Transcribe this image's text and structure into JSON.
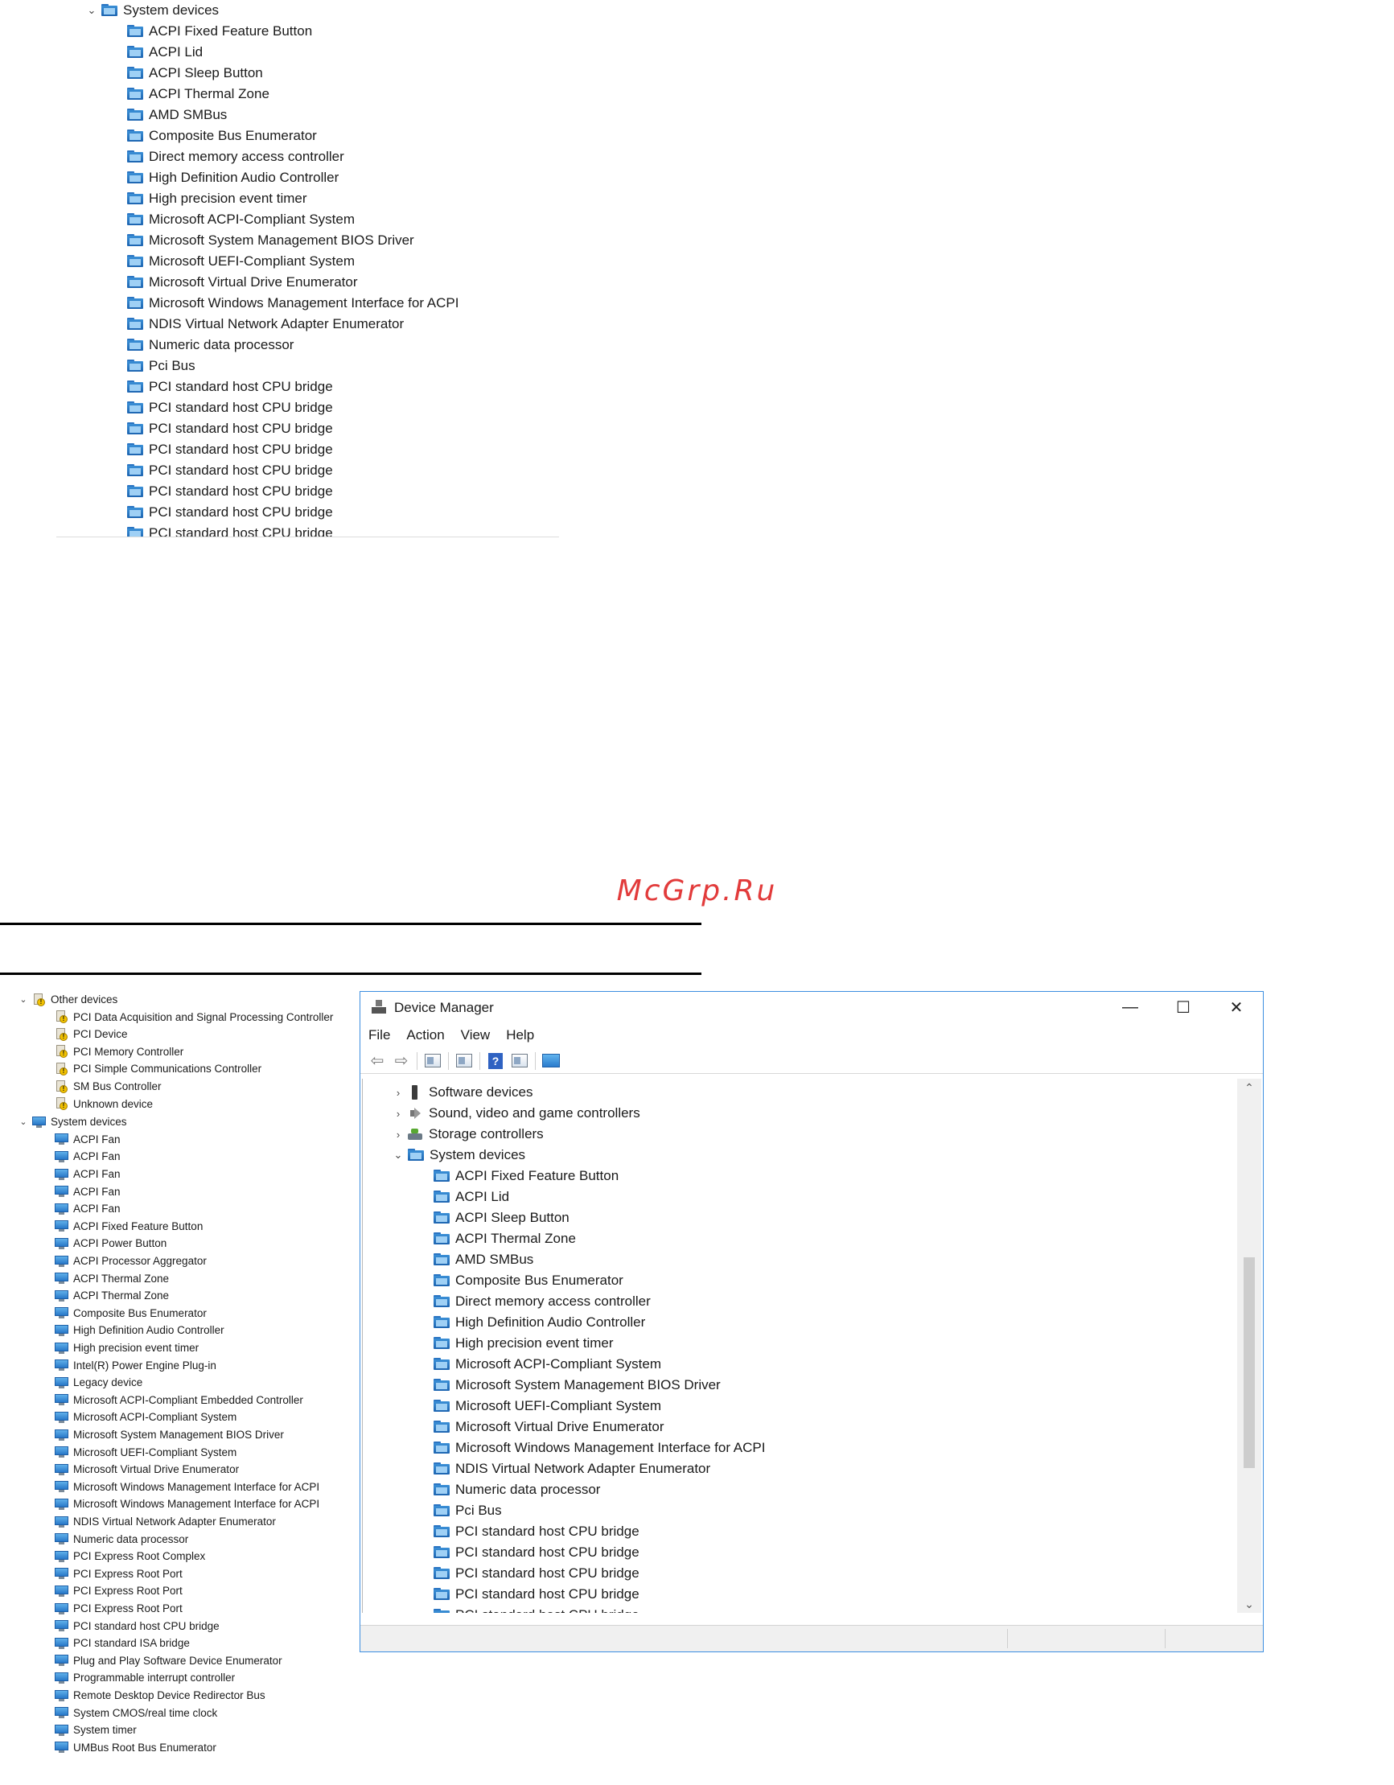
{
  "top_tree": {
    "category": "System devices",
    "items": [
      "ACPI Fixed Feature Button",
      "ACPI Lid",
      "ACPI Sleep Button",
      "ACPI Thermal Zone",
      "AMD SMBus",
      "Composite Bus Enumerator",
      "Direct memory access controller",
      "High Definition Audio Controller",
      "High precision event timer",
      "Microsoft ACPI-Compliant System",
      "Microsoft System Management BIOS Driver",
      "Microsoft UEFI-Compliant System",
      "Microsoft Virtual Drive Enumerator",
      "Microsoft Windows Management Interface for ACPI",
      "NDIS Virtual Network Adapter Enumerator",
      "Numeric data processor",
      "Pci Bus",
      "PCI standard host CPU bridge",
      "PCI standard host CPU bridge",
      "PCI standard host CPU bridge",
      "PCI standard host CPU bridge",
      "PCI standard host CPU bridge",
      "PCI standard host CPU bridge",
      "PCI standard host CPU bridge",
      "PCI standard host CPU bridge"
    ]
  },
  "watermark": "McGrp.Ru",
  "left_tree": {
    "other_category": "Other devices",
    "other_items": [
      "PCI Data Acquisition and Signal Processing Controller",
      "PCI Device",
      "PCI Memory Controller",
      "PCI Simple Communications Controller",
      "SM Bus Controller",
      "Unknown device"
    ],
    "system_category": "System devices",
    "system_items": [
      "ACPI Fan",
      "ACPI Fan",
      "ACPI Fan",
      "ACPI Fan",
      "ACPI Fan",
      "ACPI Fixed Feature Button",
      "ACPI Power Button",
      "ACPI Processor Aggregator",
      "ACPI Thermal Zone",
      "ACPI Thermal Zone",
      "Composite Bus Enumerator",
      "High Definition Audio Controller",
      "High precision event timer",
      "Intel(R) Power Engine Plug-in",
      "Legacy device",
      "Microsoft ACPI-Compliant Embedded Controller",
      "Microsoft ACPI-Compliant System",
      "Microsoft System Management BIOS Driver",
      "Microsoft UEFI-Compliant System",
      "Microsoft Virtual Drive Enumerator",
      "Microsoft Windows Management Interface for ACPI",
      "Microsoft Windows Management Interface for ACPI",
      "NDIS Virtual Network Adapter Enumerator",
      "Numeric data processor",
      "PCI Express Root Complex",
      "PCI Express Root Port",
      "PCI Express Root Port",
      "PCI Express Root Port",
      "PCI standard host CPU bridge",
      "PCI standard ISA bridge",
      "Plug and Play Software Device Enumerator",
      "Programmable interrupt controller",
      "Remote Desktop Device Redirector Bus",
      "System CMOS/real time clock",
      "System timer",
      "UMBus Root Bus Enumerator"
    ]
  },
  "window": {
    "title": "Device Manager",
    "controls": {
      "minimize": "—",
      "maximize": "☐",
      "close": "✕"
    },
    "menu": [
      "File",
      "Action",
      "View",
      "Help"
    ],
    "toolbar_icons": [
      "back-arrow-icon",
      "forward-arrow-icon",
      "properties-icon",
      "list-view-icon",
      "help-icon",
      "action-view-icon",
      "monitor-icon"
    ],
    "categories": [
      {
        "label": "Software devices",
        "icon": "software-device-icon",
        "expanded": false
      },
      {
        "label": "Sound, video and game controllers",
        "icon": "speaker-icon",
        "expanded": false
      },
      {
        "label": "Storage controllers",
        "icon": "storage-icon",
        "expanded": false
      },
      {
        "label": "System devices",
        "icon": "folder-icon",
        "expanded": true
      }
    ],
    "system_items": [
      "ACPI Fixed Feature Button",
      "ACPI Lid",
      "ACPI Sleep Button",
      "ACPI Thermal Zone",
      "AMD SMBus",
      "Composite Bus Enumerator",
      "Direct memory access controller",
      "High Definition Audio Controller",
      "High precision event timer",
      "Microsoft ACPI-Compliant System",
      "Microsoft System Management BIOS Driver",
      "Microsoft UEFI-Compliant System",
      "Microsoft Virtual Drive Enumerator",
      "Microsoft Windows Management Interface for ACPI",
      "NDIS Virtual Network Adapter Enumerator",
      "Numeric data processor",
      "Pci Bus",
      "PCI standard host CPU bridge",
      "PCI standard host CPU bridge",
      "PCI standard host CPU bridge",
      "PCI standard host CPU bridge",
      "PCI standard host CPU bridge"
    ]
  },
  "colors": {
    "accent": "#3c8ee0",
    "watermark": "#e23b3b",
    "device_icon": "#2a74c2"
  }
}
